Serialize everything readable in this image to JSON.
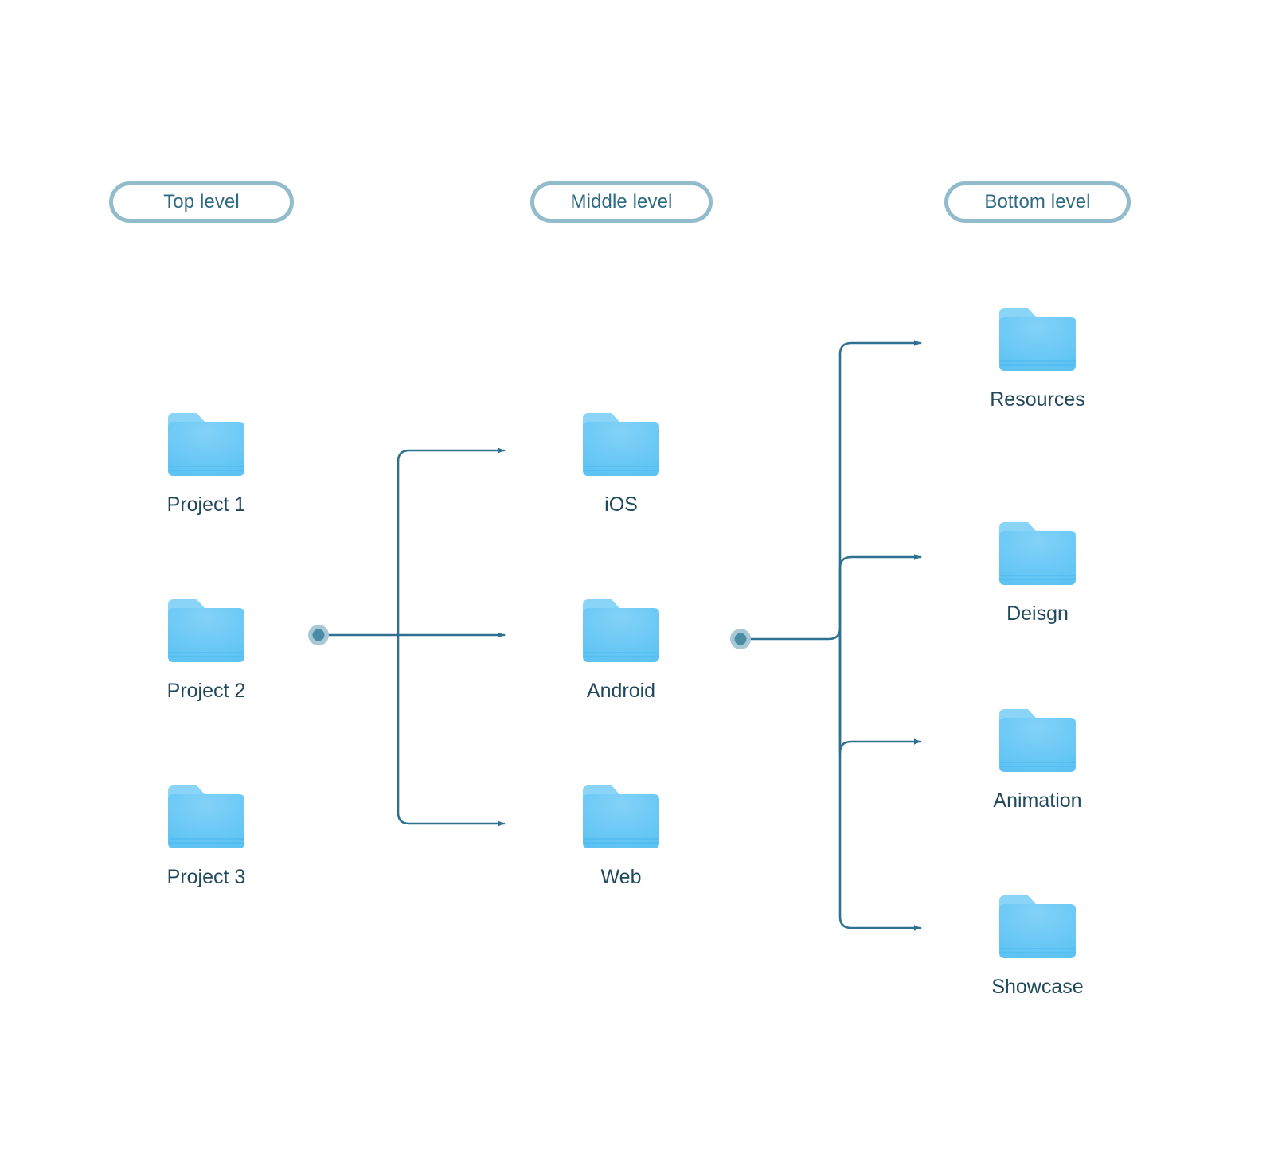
{
  "diagram": {
    "title": "Folder structure levels diagram",
    "background": "#ffffff",
    "accent_line_color": "#2f7190",
    "pill_border_color": "#92bccb",
    "pill_text_color": "#2e6a83",
    "label_text_color": "#20495c",
    "folder_front_color": "#67c9f5",
    "folder_back_color": "#8ad5f7"
  },
  "levels": [
    {
      "id": "top",
      "label": "Top level"
    },
    {
      "id": "middle",
      "label": "Middle level"
    },
    {
      "id": "bottom",
      "label": "Bottom level"
    }
  ],
  "columns": {
    "top": {
      "nodes": [
        {
          "label": "Project 1",
          "icon": "folder-icon"
        },
        {
          "label": "Project 2",
          "icon": "folder-icon"
        },
        {
          "label": "Project 3",
          "icon": "folder-icon"
        }
      ]
    },
    "middle": {
      "nodes": [
        {
          "label": "iOS",
          "icon": "folder-icon"
        },
        {
          "label": "Android",
          "icon": "folder-icon"
        },
        {
          "label": "Web",
          "icon": "folder-icon"
        }
      ]
    },
    "bottom": {
      "nodes": [
        {
          "label": "Resources",
          "icon": "folder-icon"
        },
        {
          "label": "Deisgn",
          "icon": "folder-icon"
        },
        {
          "label": "Animation",
          "icon": "folder-icon"
        },
        {
          "label": "Showcase",
          "icon": "folder-icon"
        }
      ]
    }
  },
  "connectors": [
    {
      "id": "top-to-middle",
      "source": "Project 2",
      "targets": [
        "iOS",
        "Android",
        "Web"
      ],
      "branches": 3
    },
    {
      "id": "middle-to-bottom",
      "source": "Android",
      "targets": [
        "Resources",
        "Deisgn",
        "Animation",
        "Showcase"
      ],
      "branches": 4
    }
  ]
}
